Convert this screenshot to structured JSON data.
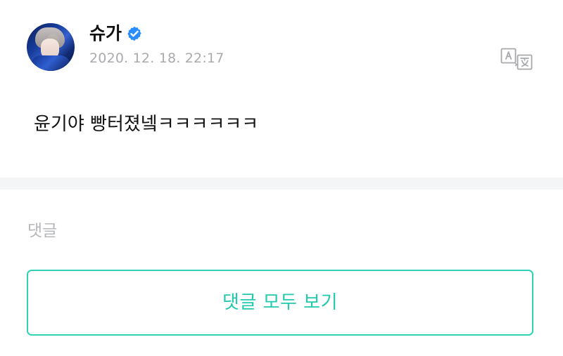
{
  "post": {
    "author": "슈가",
    "timestamp": "2020. 12. 18. 22:17",
    "body": "윤기야 빵터졌넼ㅋㅋㅋㅋㅋㅋ",
    "verified_icon": "verified-badge",
    "translate_icon": "translate-icon"
  },
  "comments": {
    "section_title": "댓글",
    "view_all_label": "댓글 모두 보기"
  },
  "colors": {
    "accent": "#22c9af",
    "verified": "#2a8cff",
    "muted": "#a8aaad",
    "divider": "#f4f5f7"
  }
}
